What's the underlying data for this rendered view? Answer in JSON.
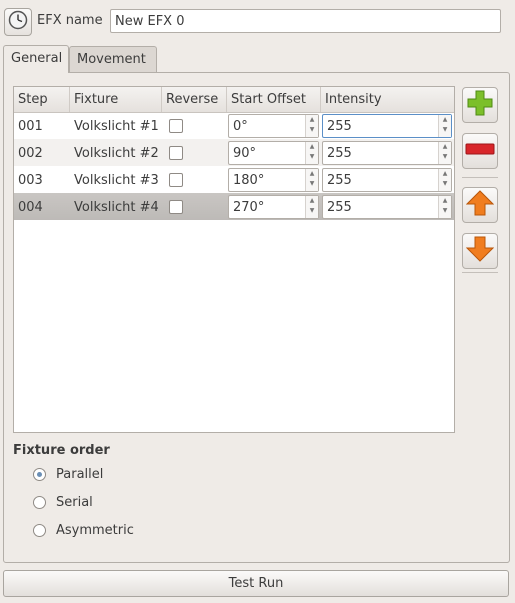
{
  "efx_label": "EFX name",
  "efx_name_value": "New EFX 0",
  "tabs": [
    {
      "label": "General",
      "active": true
    },
    {
      "label": "Movement",
      "active": false
    }
  ],
  "table": {
    "headers": [
      "Step",
      "Fixture",
      "Reverse",
      "Start Offset",
      "Intensity"
    ],
    "rows": [
      {
        "step": "001",
        "fixture": "Volkslicht #1",
        "reverse": false,
        "offset": "0°",
        "intensity": "255"
      },
      {
        "step": "002",
        "fixture": "Volkslicht #2",
        "reverse": false,
        "offset": "90°",
        "intensity": "255"
      },
      {
        "step": "003",
        "fixture": "Volkslicht #3",
        "reverse": false,
        "offset": "180°",
        "intensity": "255"
      },
      {
        "step": "004",
        "fixture": "Volkslicht #4",
        "reverse": false,
        "offset": "270°",
        "intensity": "255"
      }
    ],
    "selected_row": 4
  },
  "side_buttons": [
    {
      "name": "add-icon",
      "color": "#7cbf2a"
    },
    {
      "name": "remove-icon",
      "color": "#d8262a"
    },
    {
      "name": "arrow-up-icon",
      "color": "#f07d1f"
    },
    {
      "name": "arrow-down-icon",
      "color": "#f07d1f"
    }
  ],
  "fixture_order": {
    "title": "Fixture order",
    "options": [
      "Parallel",
      "Serial",
      "Asymmetric"
    ],
    "selected": "Parallel"
  },
  "test_run_label": "Test Run"
}
